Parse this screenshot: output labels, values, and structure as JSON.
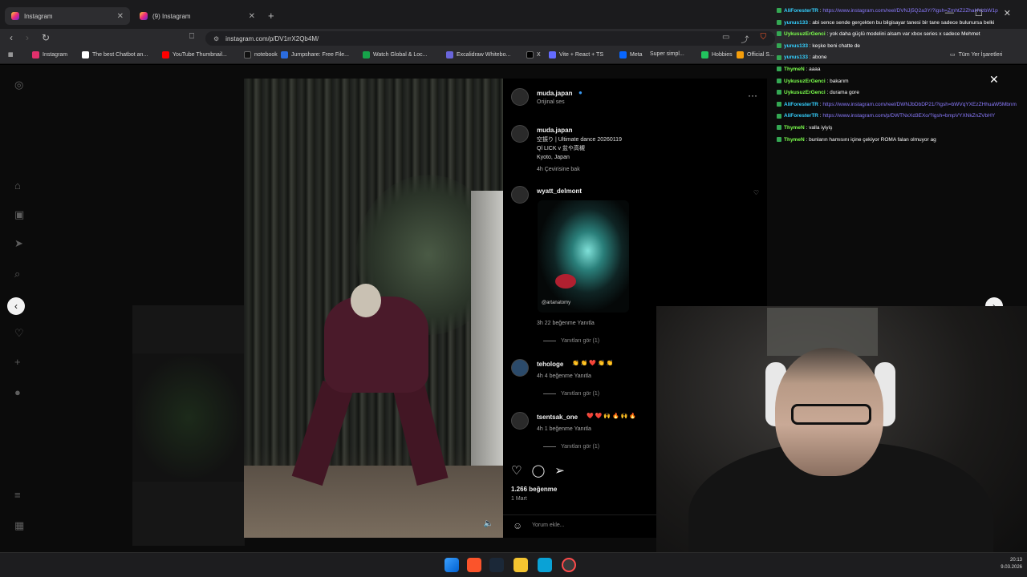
{
  "browser": {
    "tabs": [
      {
        "label": "Instagram",
        "active": true
      },
      {
        "label": "(9) Instagram",
        "active": false
      }
    ],
    "new_tab_icon": "plus-icon",
    "window_controls": [
      "minimize-icon",
      "maximize-icon",
      "close-icon"
    ],
    "url": "instagram.com/p/DV1rrX2Qb4M/",
    "bookmarks": [
      {
        "label": "Instagram",
        "color": "#e1306c"
      },
      {
        "label": "The best Chatbot an...",
        "color": "#ffffff"
      },
      {
        "label": "YouTube Thumbnail...",
        "color": "#ff0000"
      },
      {
        "label": "notebook",
        "color": "#111111"
      },
      {
        "label": "Jumpshare: Free File...",
        "color": "#2b6cdf"
      },
      {
        "label": "Watch Global & Loc...",
        "color": "#16a34a"
      },
      {
        "label": "Excalidraw Whitebo...",
        "color": "#6965db"
      },
      {
        "label": "X",
        "color": "#000000"
      },
      {
        "label": "Vite + React + TS",
        "color": "#646cff"
      },
      {
        "label": "Meta",
        "color": "#0866ff"
      },
      {
        "label": "Super simpl...",
        "color": "#ffffff"
      },
      {
        "label": "Hobbies",
        "color": "#22c55e"
      },
      {
        "label": "Official S...",
        "color": "#f59e0b"
      }
    ],
    "all_bookmarks_label": "Tüm Yer İşaretleri"
  },
  "instagram": {
    "left_nav": [
      "home-icon",
      "reels-icon",
      "messages-icon",
      "search-icon",
      "notifications-icon",
      "create-icon",
      "profile-icon",
      "menu-icon",
      "more-icon"
    ],
    "post": {
      "author": "muda.japan",
      "audio": "Orijinal ses",
      "caption_author": "muda.japan",
      "caption_lines": [
        "空振り | Ultimate dance 20260119",
        "Ql LICK v 盆や高槻",
        "Kyoto, Japan"
      ],
      "caption_meta": "4h   Çevirisine bak",
      "comments": [
        {
          "user": "wyatt_delmont",
          "meta": "3h   22 beğenme   Yanıtla",
          "replies": "Yanıtları gör (1)",
          "image_caption": "@artanatomy"
        },
        {
          "user": "tehologe",
          "text": "👏 👏 ❤️ 👏 👏",
          "meta": "4h   4 beğenme   Yanıtla",
          "replies": "Yanıtları gör (1)"
        },
        {
          "user": "tsentsak_one",
          "text": "❤️ ❤️ 🙌 🔥 🙌 🔥",
          "meta": "4h   1 beğenme   Yanıtla",
          "replies": "Yanıtları gör (1)"
        }
      ],
      "likes": "1.266 beğenme",
      "time": "1 Mart",
      "comment_placeholder": "Yorum ekle..."
    }
  },
  "chat": [
    {
      "user": "AliForesterTR",
      "color": "#35d0ff",
      "text": "https://www.instagram.com/reel/DVNJj5Q2a3Y/?igsh=ZmhtZ2ZhaHVzbW1p"
    },
    {
      "user": "yunus133",
      "color": "#35d0ff",
      "text": "abi sence sende gerçekten bu bilgisayar tanesi bir tane sadece bulunursa belki"
    },
    {
      "user": "UykusuzErGenci",
      "color": "#7cff4d",
      "text": "yok daha güçlü modelini alsam var xbox series x sadece Mehmet"
    },
    {
      "user": "yunus133",
      "color": "#35d0ff",
      "text": "keşke beni chatte de"
    },
    {
      "user": "yunus133",
      "color": "#35d0ff",
      "text": "abone"
    },
    {
      "user": "ThymeN",
      "color": "#7cff4d",
      "text": "aaaa"
    },
    {
      "user": "UykusuzErGenci",
      "color": "#7cff4d",
      "text": "bakarım"
    },
    {
      "user": "UykusuzErGenci",
      "color": "#7cff4d",
      "text": "durama gore"
    },
    {
      "user": "AliForesterTR",
      "color": "#35d0ff",
      "text": "https://www.instagram.com/reel/DWNJbDbDP21/?igsh=bWVqYXEzZHhuaW5Mbnm"
    },
    {
      "user": "AliForesterTR",
      "color": "#35d0ff",
      "text": "https://www.instagram.com/p/DWTNxXd3EXo/?igsh=bmpVYXNkZnZVbHY"
    },
    {
      "user": "ThymeN",
      "color": "#7cff4d",
      "text": "valla iyiyiş"
    },
    {
      "user": "ThymeN",
      "color": "#7cff4d",
      "text": "bunların hamısını içine çekiyor ROMA falan olmuyor ag"
    }
  ],
  "taskbar": {
    "apps": [
      "windows-start-icon",
      "brave-icon",
      "steam-icon",
      "file-explorer-icon",
      "store-icon",
      "obs-icon"
    ],
    "time": "20:13",
    "date": "9.03.2026"
  }
}
